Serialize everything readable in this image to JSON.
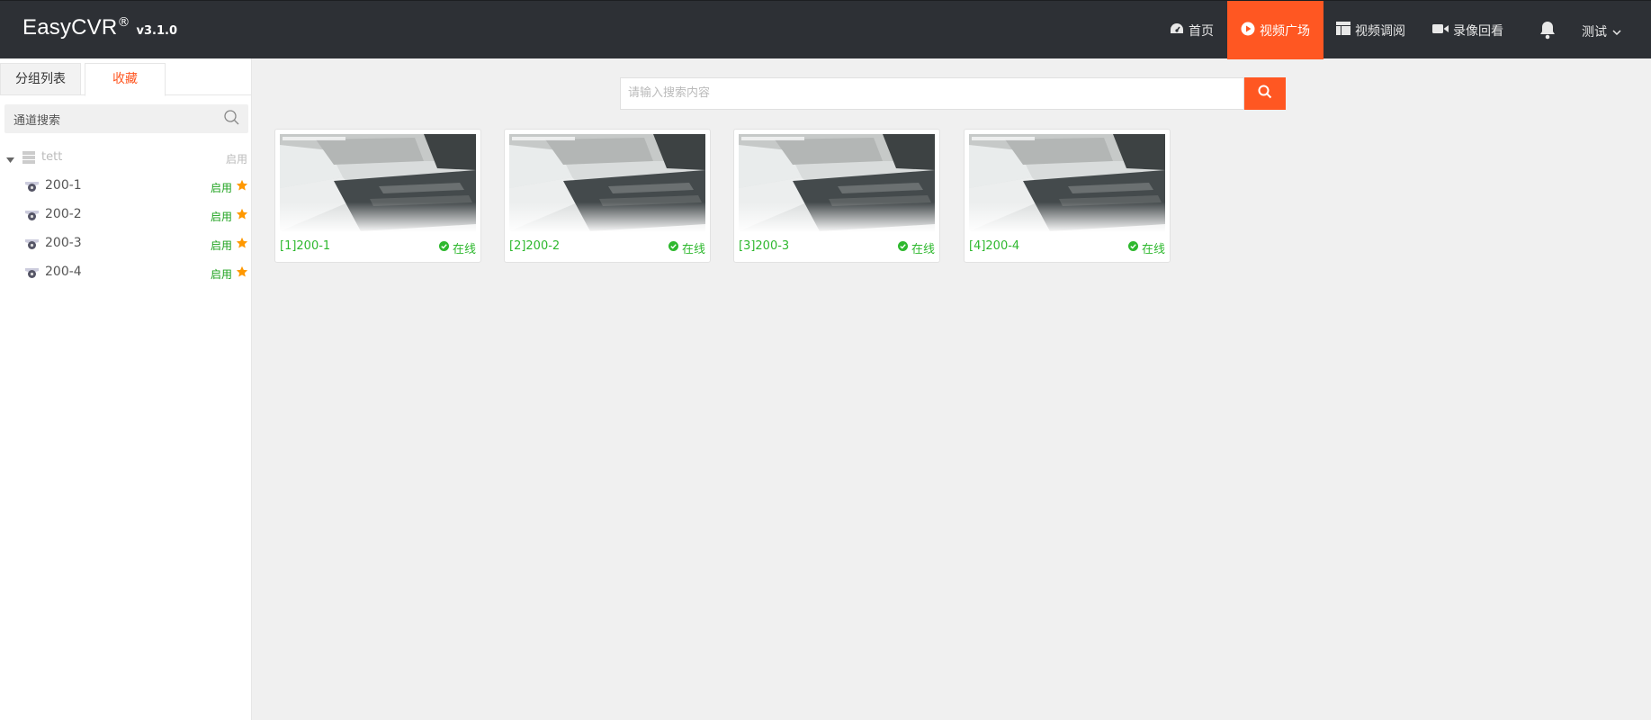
{
  "app": {
    "name": "EasyCVR",
    "reg": "®",
    "version": "v3.1.0"
  },
  "nav": {
    "home": "首页",
    "square": "视频广场",
    "tune": "视频调阅",
    "record": "录像回看",
    "user": "测试"
  },
  "sidebar": {
    "tabs": {
      "group": "分组列表",
      "favorites": "收藏"
    },
    "search_placeholder": "通道搜索",
    "root": {
      "label": "tett",
      "status": "启用"
    },
    "items": [
      {
        "label": "200-1",
        "status": "启用"
      },
      {
        "label": "200-2",
        "status": "启用"
      },
      {
        "label": "200-3",
        "status": "启用"
      },
      {
        "label": "200-4",
        "status": "启用"
      }
    ]
  },
  "main": {
    "search_placeholder": "请输入搜索内容",
    "cards": [
      {
        "name": "[1]200-1",
        "status": "在线"
      },
      {
        "name": "[2]200-2",
        "status": "在线"
      },
      {
        "name": "[3]200-3",
        "status": "在线"
      },
      {
        "name": "[4]200-4",
        "status": "在线"
      }
    ]
  },
  "colors": {
    "accent": "#ff5722",
    "online": "#2eb82e",
    "topbar": "#2d3035",
    "star": "#ff9800"
  }
}
